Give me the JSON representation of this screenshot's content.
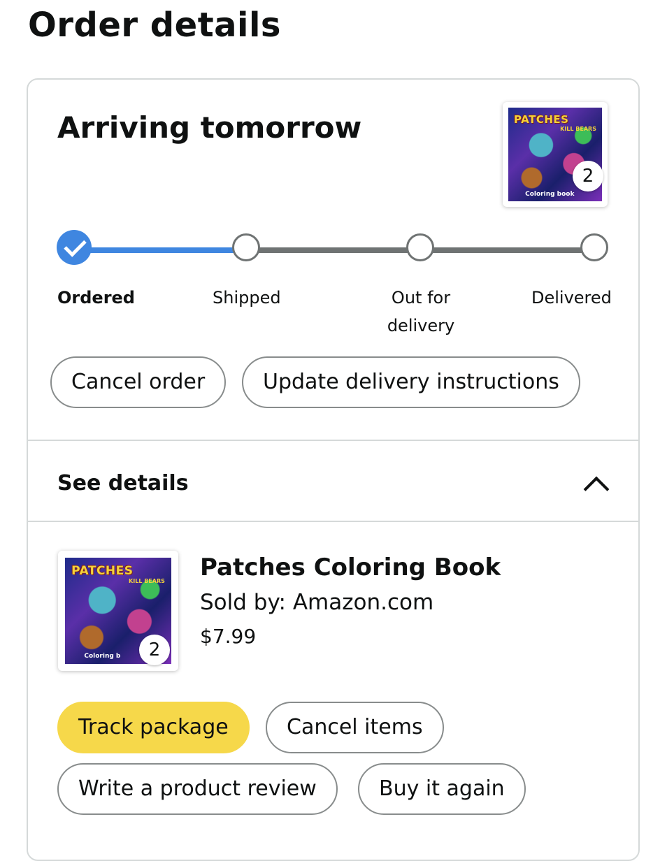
{
  "page": {
    "title": "Order details"
  },
  "shipment": {
    "status": "Arriving tomorrow",
    "thumbnail": {
      "cover_title": "PATCHES",
      "cover_subtitle": "KILL BEARS",
      "cover_caption": "Coloring book",
      "quantity": "2"
    },
    "progress": {
      "current_step_index": 0,
      "fraction_complete": 0.33,
      "steps": [
        {
          "label": "Ordered",
          "state": "done"
        },
        {
          "label": "Shipped",
          "state": "pending"
        },
        {
          "label": "Out for delivery",
          "state": "pending"
        },
        {
          "label": "Delivered",
          "state": "pending"
        }
      ]
    },
    "actions": {
      "cancel_order": "Cancel order",
      "update_instructions": "Update delivery instructions"
    }
  },
  "details": {
    "toggle_label": "See details",
    "expanded": true
  },
  "item": {
    "title": "Patches Coloring Book",
    "seller": "Sold by: Amazon.com",
    "price": "$7.99",
    "thumbnail": {
      "cover_title": "PATCHES",
      "cover_subtitle": "KILL BEARS",
      "cover_caption": "Coloring b",
      "quantity": "2"
    },
    "actions": {
      "track_package": "Track package",
      "cancel_items": "Cancel items",
      "write_review": "Write a product review",
      "buy_again": "Buy it again"
    }
  },
  "colors": {
    "progress_blue": "#3f86e0",
    "primary_button": "#f6d84a",
    "border": "#d5d9d9",
    "text": "#0f1111"
  },
  "icons": {
    "checkmark": "check-icon",
    "collapse": "chevron-up-icon"
  }
}
